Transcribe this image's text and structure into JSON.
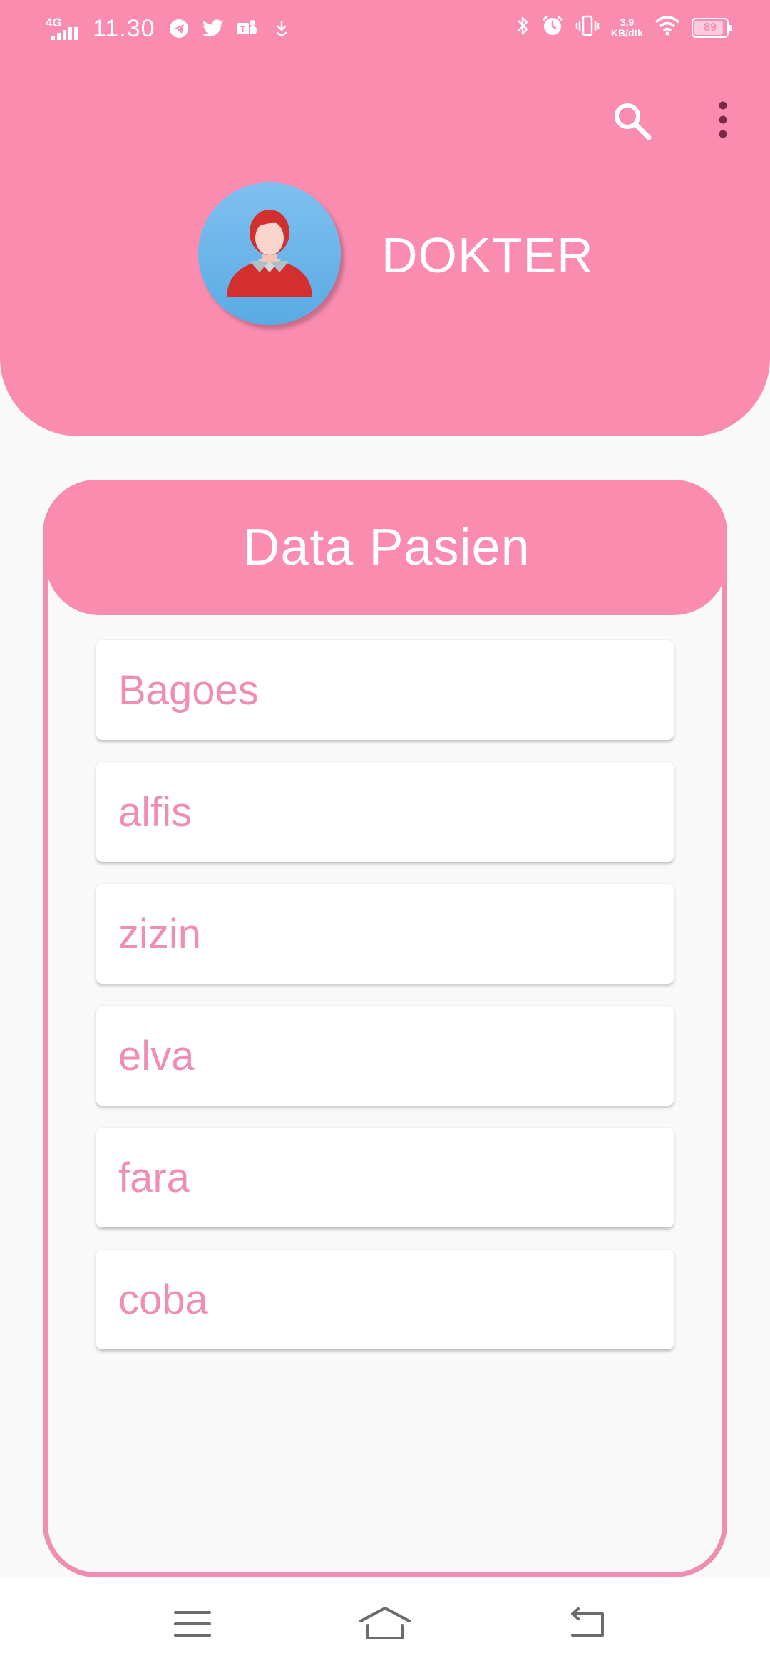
{
  "status_bar": {
    "network": "4G",
    "time": "11.30",
    "speed_value": "3,9",
    "speed_unit": "KB/dtk",
    "battery": "89",
    "icons": [
      "telegram-icon",
      "twitter-icon",
      "teams-icon",
      "download-icon",
      "bluetooth-icon",
      "alarm-icon",
      "vibrate-icon",
      "wifi-icon",
      "battery-icon"
    ]
  },
  "header": {
    "title": "DOKTER",
    "avatar": "doctor-avatar",
    "actions": [
      "search-icon",
      "more-vert-icon"
    ]
  },
  "card": {
    "title": "Data Pasien",
    "patients": [
      "Bagoes",
      "alfis",
      "zizin",
      "elva",
      "fara",
      "coba"
    ]
  },
  "nav": [
    "menu-icon",
    "home-icon",
    "back-icon"
  ],
  "colors": {
    "primary": "#fa8cb0",
    "text_accent": "#ef8db3",
    "background": "#f9f9f9"
  }
}
